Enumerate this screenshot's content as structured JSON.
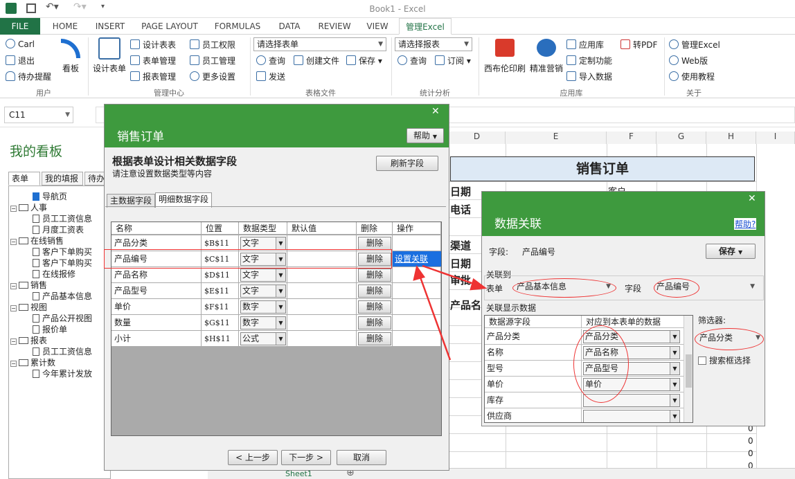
{
  "window": {
    "title": "Book1 - Excel"
  },
  "ribbon_tabs": [
    "FILE",
    "HOME",
    "INSERT",
    "PAGE LAYOUT",
    "FORMULAS",
    "DATA",
    "REVIEW",
    "VIEW",
    "管理Excel"
  ],
  "ribbon": {
    "user": {
      "name": "Carl",
      "logout": "退出",
      "todo": "待办提醒",
      "board": "看板",
      "group": "用户"
    },
    "manage": {
      "design_table_big": "设计表单",
      "design_table": "设计表表",
      "form_manage": "表单管理",
      "report_manage": "报表管理",
      "emp_perm": "员工权限",
      "emp_manage": "员工管理",
      "more_settings": "更多设置",
      "group": "管理中心"
    },
    "table_file": {
      "select_placeholder": "请选择表单",
      "query": "查询",
      "create_file": "创建文件",
      "save": "保存",
      "send": "发送",
      "group": "表格文件"
    },
    "stats": {
      "select_placeholder": "请选择报表",
      "query": "查询",
      "subscribe": "订阅",
      "group": "统计分析"
    },
    "apps": {
      "print": "西布伦印刷",
      "marketing": "精准营销",
      "app_store": "应用库",
      "custom_func": "定制功能",
      "import_data": "导入数据",
      "to_pdf": "转PDF",
      "group": "应用库"
    },
    "about": {
      "manage_excel": "管理Excel",
      "web_version": "Web版",
      "tutorial": "使用教程",
      "group": "关于"
    }
  },
  "namebox": "C11",
  "left_panel": {
    "title": "我的看板",
    "tabs": [
      "表单",
      "我的填报",
      "待办"
    ],
    "tree": [
      {
        "label": "导航页",
        "level": 1,
        "type": "nav"
      },
      {
        "label": "人事",
        "level": 0,
        "type": "folder"
      },
      {
        "label": "员工工资信息",
        "level": 1,
        "type": "doc"
      },
      {
        "label": "月度工资表",
        "level": 1,
        "type": "doc"
      },
      {
        "label": "在线销售",
        "level": 0,
        "type": "folder"
      },
      {
        "label": "客户下单购买",
        "level": 1,
        "type": "doc"
      },
      {
        "label": "客户下单购买",
        "level": 1,
        "type": "doc"
      },
      {
        "label": "在线报修",
        "level": 1,
        "type": "doc"
      },
      {
        "label": "销售",
        "level": 0,
        "type": "folder"
      },
      {
        "label": "产品基本信息",
        "level": 1,
        "type": "doc"
      },
      {
        "label": "视图",
        "level": 0,
        "type": "folder"
      },
      {
        "label": "产品公开视图",
        "level": 1,
        "type": "view"
      },
      {
        "label": "报价单",
        "level": 1,
        "type": "view"
      },
      {
        "label": "报表",
        "level": 0,
        "type": "folder"
      },
      {
        "label": "员工工资信息",
        "level": 1,
        "type": "chart"
      },
      {
        "label": "累计数",
        "level": 0,
        "type": "folder"
      },
      {
        "label": "今年累计发放",
        "level": 1,
        "type": "sum"
      }
    ]
  },
  "sheet": {
    "columns": [
      "D",
      "E",
      "F",
      "G",
      "H",
      "I"
    ],
    "title": "销售订单",
    "labels": [
      "日期",
      "电话",
      "渠道",
      "日期",
      "审批",
      "产品名称"
    ],
    "customer_label": "客户",
    "zeros": [
      "0",
      "0",
      "0",
      "0"
    ],
    "sheet_tab": "Sheet1"
  },
  "dialog1": {
    "title": "销售订单",
    "help": "帮助",
    "heading": "根据表单设计相关数据字段",
    "subheading": "请注意设置数据类型等内容",
    "refresh": "刷新字段",
    "tabs": [
      "主数据字段",
      "明细数据字段"
    ],
    "columns": [
      "名称",
      "位置",
      "数据类型",
      "默认值",
      "删除",
      "操作"
    ],
    "rows": [
      {
        "name": "产品分类",
        "pos": "$B$11",
        "type": "文字",
        "del": "删除",
        "op": ""
      },
      {
        "name": "产品编号",
        "pos": "$C$11",
        "type": "文字",
        "del": "删除",
        "op": "设置关联"
      },
      {
        "name": "产品名称",
        "pos": "$D$11",
        "type": "文字",
        "del": "删除",
        "op": ""
      },
      {
        "name": "产品型号",
        "pos": "$E$11",
        "type": "文字",
        "del": "删除",
        "op": ""
      },
      {
        "name": "单价",
        "pos": "$F$11",
        "type": "数字",
        "del": "删除",
        "op": ""
      },
      {
        "name": "数量",
        "pos": "$G$11",
        "type": "数字",
        "del": "删除",
        "op": ""
      },
      {
        "name": "小计",
        "pos": "$H$11",
        "type": "公式",
        "del": "删除",
        "op": ""
      }
    ],
    "prev": "< 上一步",
    "next": "下一步 >",
    "cancel": "取消"
  },
  "dialog2": {
    "title": "数据关联",
    "help": "帮助?",
    "field_label": "字段:",
    "field_value": "产品编号",
    "save": "保存",
    "link_to": "关联到",
    "table_label": "表单",
    "table_value": "产品基本信息",
    "field2_label": "字段",
    "field2_value": "产品编号",
    "display_data": "关联显示数据",
    "grid_headers": [
      "数据源字段",
      "对应到本表单的数据"
    ],
    "grid_rows": [
      {
        "src": "产品分类",
        "dst": "产品分类"
      },
      {
        "src": "名称",
        "dst": "产品名称"
      },
      {
        "src": "型号",
        "dst": "产品型号"
      },
      {
        "src": "单价",
        "dst": "单价"
      },
      {
        "src": "库存",
        "dst": ""
      },
      {
        "src": "供应商",
        "dst": ""
      }
    ],
    "filter_label": "筛选器:",
    "filter_value": "产品分类",
    "search_box": "搜索框选择"
  }
}
